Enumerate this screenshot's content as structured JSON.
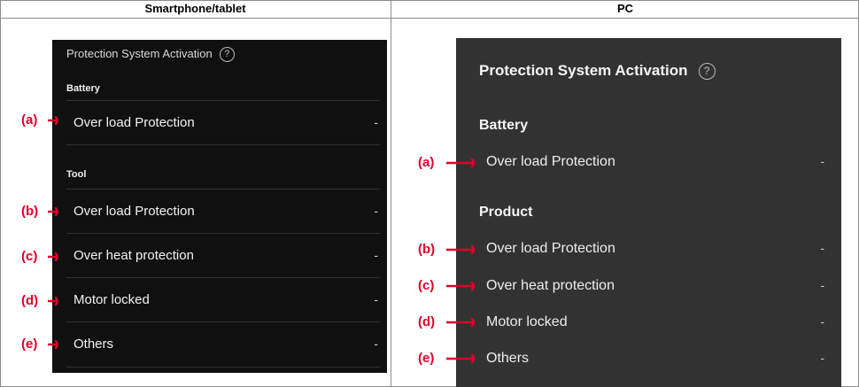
{
  "columns": {
    "left": "Smartphone/tablet",
    "right": "PC"
  },
  "smartphone": {
    "title": "Protection System Activation",
    "help_glyph": "?",
    "sections": {
      "battery": "Battery",
      "tool": "Tool"
    },
    "rows": [
      {
        "label": "Over load Protection",
        "value": "-"
      },
      {
        "label": "Over load Protection",
        "value": "-"
      },
      {
        "label": "Over heat protection",
        "value": "-"
      },
      {
        "label": "Motor locked",
        "value": "-"
      },
      {
        "label": "Others",
        "value": "-"
      }
    ]
  },
  "pc": {
    "title": "Protection System Activation",
    "help_glyph": "?",
    "sections": {
      "battery": "Battery",
      "product": "Product"
    },
    "rows": [
      {
        "label": "Over load Protection",
        "value": "-"
      },
      {
        "label": "Over load Protection",
        "value": "-"
      },
      {
        "label": "Over heat protection",
        "value": "-"
      },
      {
        "label": "Motor locked",
        "value": "-"
      },
      {
        "label": "Others",
        "value": "-"
      }
    ]
  },
  "callouts": [
    "(a)",
    "(b)",
    "(c)",
    "(d)",
    "(e)"
  ],
  "colors": {
    "callout": "#e0002a",
    "phone_bg": "#101010",
    "pc_bg": "#323232"
  }
}
